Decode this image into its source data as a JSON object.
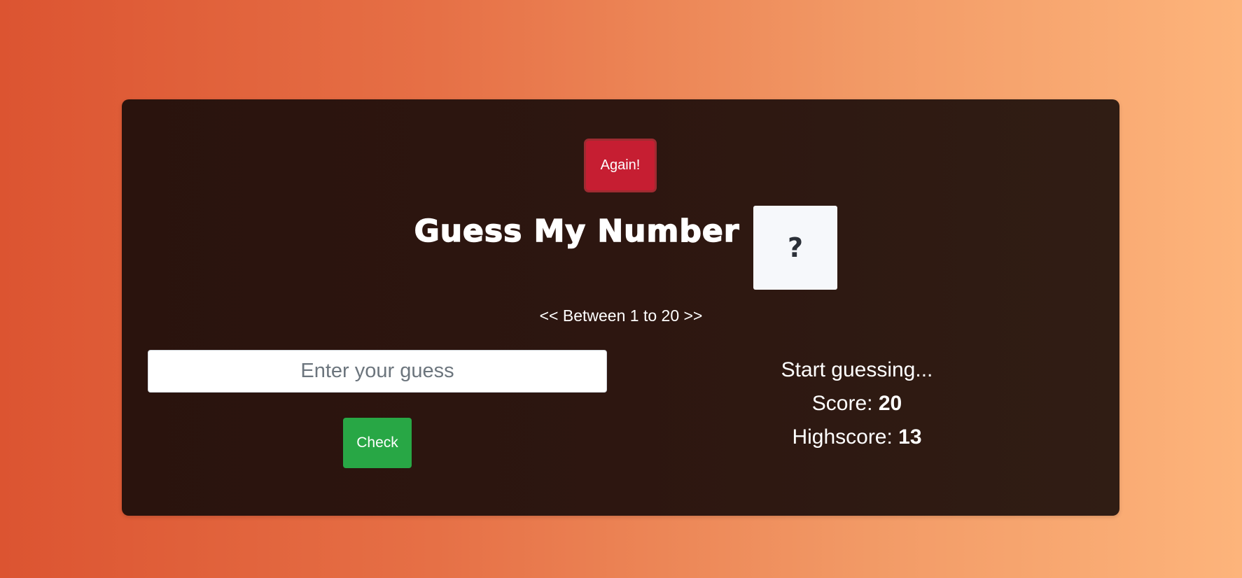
{
  "app": {
    "again_label": "Again!",
    "title": "Guess My Number",
    "secret_number_display": "?",
    "range_hint": "<< Between 1 to 20 >>",
    "guess_input": {
      "value": "",
      "placeholder": "Enter your guess"
    },
    "check_label": "Check",
    "message": "Start guessing...",
    "score_label": "Score: ",
    "score_value": "20",
    "highscore_label": "Highscore: ",
    "highscore_value": "13"
  },
  "colors": {
    "background_start": "#dc5431",
    "background_end": "#fdb47b",
    "card": "#2d1610",
    "again_button": "#c61e32",
    "check_button": "#28a745",
    "number_box": "#f6f8fb"
  }
}
